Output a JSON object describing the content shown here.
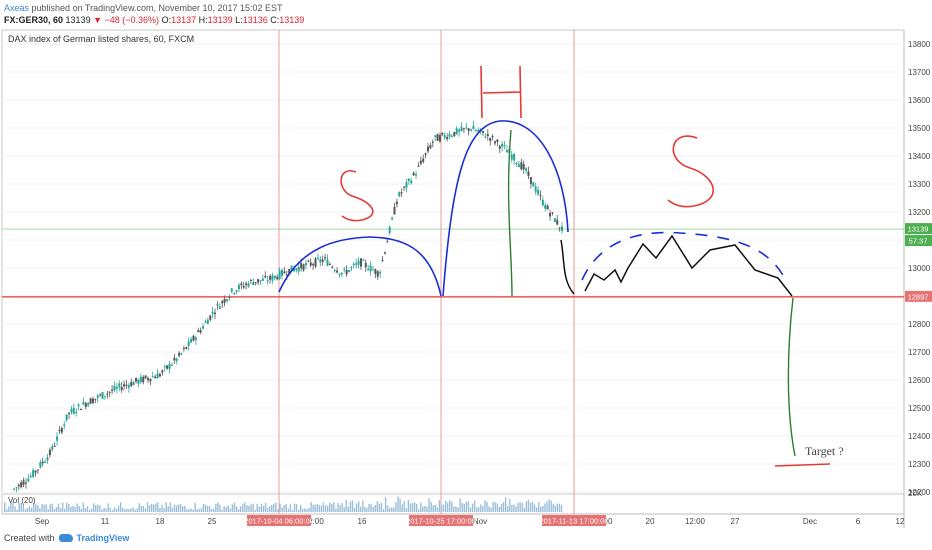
{
  "header": {
    "user": "Axeas",
    "published": "published on TradingView.com, November 10, 2017 15:02 EST",
    "symbol": "FX:GER30, 60",
    "last": "13139",
    "change": "▼ −48 (−0.36%)",
    "o_label": "O:",
    "o": "13137",
    "h_label": "H:",
    "h": "13139",
    "l_label": "L:",
    "l": "13136",
    "c_label": "C:",
    "c": "13139"
  },
  "legend": "DAX index of German listed shares, 60, FXCM",
  "volume_label": "Vol (20)",
  "footer": {
    "created": "Created with",
    "brand": "TradingView"
  },
  "annotations": {
    "s_left": "S",
    "h_mid": "H",
    "s_right": "S",
    "target": "Target ?"
  },
  "colors": {
    "neckline": "#e53935",
    "shoulder": "#1b2fd6",
    "projection": "#2e7d32",
    "candle_up": "#26a69a",
    "candle_down": "#555555",
    "badge_green": "#4caf50",
    "badge_red": "#e57373",
    "volume": "#9bbfd8"
  },
  "chart_data": {
    "type": "candlestick",
    "symbol": "FX:GER30",
    "timeframe": "60",
    "ylim": [
      12200,
      13850
    ],
    "y_ticks": [
      12200,
      12300,
      12400,
      12500,
      12600,
      12700,
      12800,
      12900,
      13000,
      13100,
      13200,
      13300,
      13400,
      13500,
      13600,
      13700,
      13800
    ],
    "x_ticks": [
      "Sep",
      "11",
      "18",
      "25",
      "2:00",
      "16",
      "",
      "Nov",
      "",
      "00",
      "20",
      "12:00",
      "27",
      "Dec",
      "6",
      "12"
    ],
    "x_date_markers": [
      "2017-10-04 06:00:00",
      "2017-10-25 17:00:00",
      "2017-11-13 17:00:00"
    ],
    "last_price": 13139,
    "last_price_badge": "13139",
    "countdown_badge": "57:37",
    "neckline": 12897,
    "neckline_badge": "12897",
    "target": 12300,
    "volume_axis": "20K",
    "price_path": [
      [
        "Sep 1",
        12210
      ],
      [
        "Sep 5",
        12260
      ],
      [
        "Sep 7",
        12340
      ],
      [
        "Sep 11",
        12480
      ],
      [
        "Sep 13",
        12520
      ],
      [
        "Sep 18",
        12550
      ],
      [
        "Sep 20",
        12580
      ],
      [
        "Sep 22",
        12600
      ],
      [
        "Sep 25",
        12620
      ],
      [
        "Sep 27",
        12680
      ],
      [
        "Sep 29",
        12760
      ],
      [
        "Oct 2",
        12850
      ],
      [
        "Oct 4",
        12920
      ],
      [
        "Oct 6",
        12950
      ],
      [
        "Oct 10",
        12960
      ],
      [
        "Oct 12",
        12990
      ],
      [
        "Oct 16",
        13010
      ],
      [
        "Oct 18",
        13030
      ],
      [
        "Oct 20",
        12980
      ],
      [
        "Oct 23",
        13020
      ],
      [
        "Oct 25",
        12980
      ],
      [
        "Oct 26",
        13250
      ],
      [
        "Oct 27",
        13340
      ],
      [
        "Oct 30",
        13460
      ],
      [
        "Nov 1",
        13480
      ],
      [
        "Nov 3",
        13500
      ],
      [
        "Nov 6",
        13470
      ],
      [
        "Nov 7",
        13420
      ],
      [
        "Nov 8",
        13350
      ],
      [
        "Nov 9",
        13230
      ],
      [
        "Nov 10",
        13139
      ]
    ]
  }
}
